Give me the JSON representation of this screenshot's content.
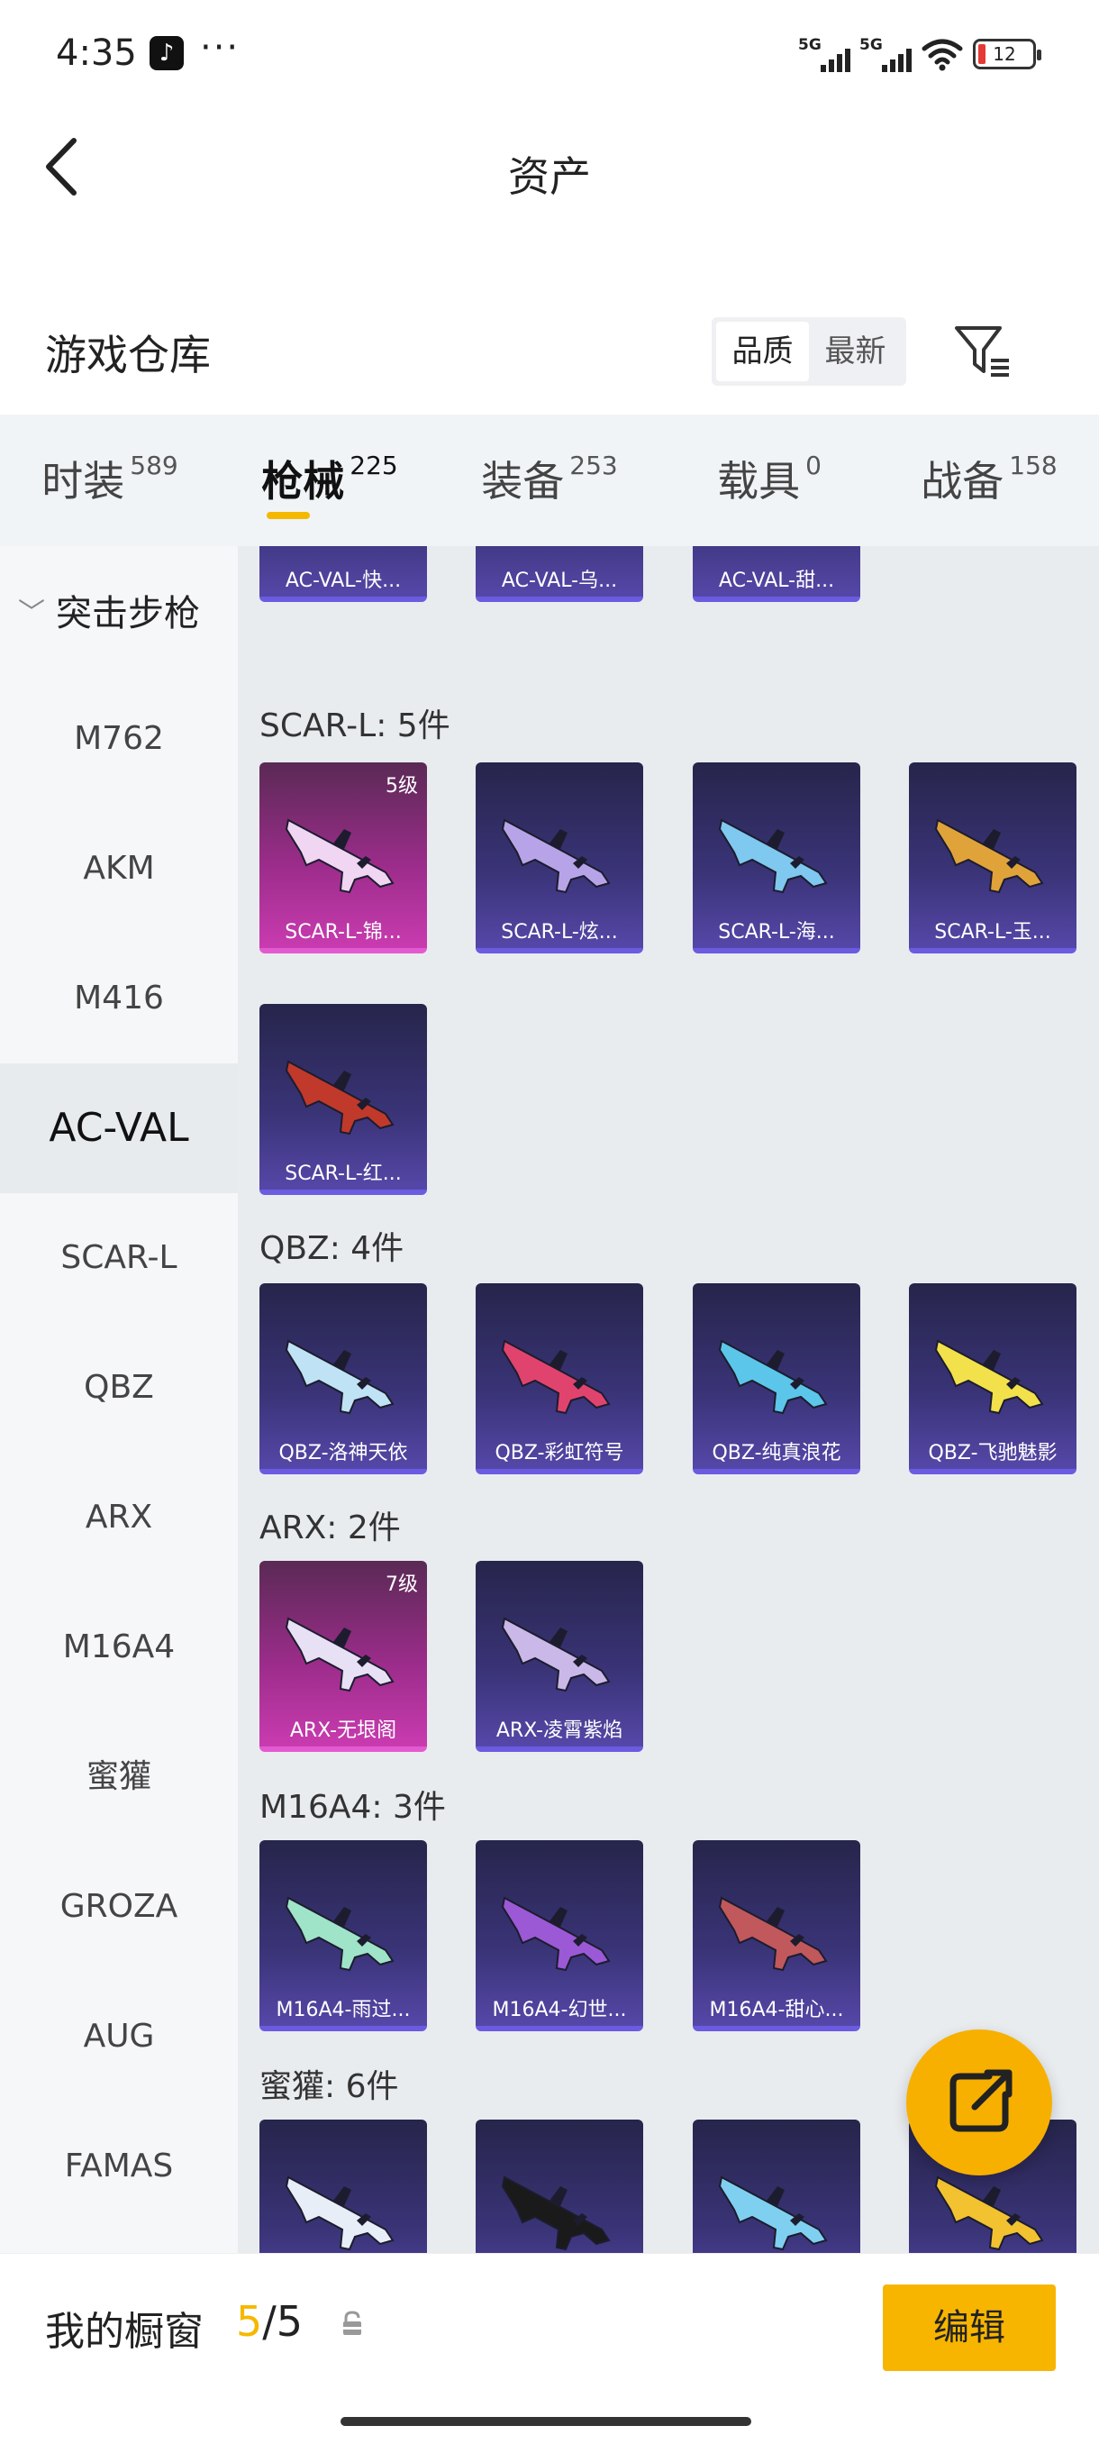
{
  "status_bar": {
    "time": "4:35",
    "app_icon": "tiktok-icon",
    "dots": "···",
    "signal1": "5G",
    "signal2": "5G",
    "battery": "12"
  },
  "nav": {
    "title": "资产",
    "back_icon": "back-arrow-icon"
  },
  "warehouse": {
    "title": "游戏仓库",
    "sort_options": [
      "品质",
      "最新"
    ],
    "selected_sort": "品质",
    "filter_icon": "filter-icon"
  },
  "tabs": [
    {
      "label": "时装",
      "count": "589"
    },
    {
      "label": "枪械",
      "count": "225"
    },
    {
      "label": "装备",
      "count": "253"
    },
    {
      "label": "载具",
      "count": "0"
    },
    {
      "label": "战备",
      "count": "158"
    }
  ],
  "active_tab": "枪械",
  "sidebar": {
    "group": "突击步枪",
    "items": [
      "M762",
      "AKM",
      "M416",
      "AC-VAL",
      "SCAR-L",
      "QBZ",
      "ARX",
      "M16A4",
      "蜜獾",
      "GROZA",
      "AUG",
      "FAMAS"
    ],
    "active": "AC-VAL"
  },
  "groups": [
    {
      "title": "",
      "cards": [
        {
          "name": "AC-VAL-快...",
          "level": "",
          "rarity": "purple"
        },
        {
          "name": "AC-VAL-乌...",
          "level": "",
          "rarity": "purple"
        },
        {
          "name": "AC-VAL-甜...",
          "level": "",
          "rarity": "purple"
        }
      ]
    },
    {
      "title": "SCAR-L: 5件",
      "cards": [
        {
          "name": "SCAR-L-锦...",
          "level": "5级",
          "rarity": "pink"
        },
        {
          "name": "SCAR-L-炫...",
          "level": "",
          "rarity": "purple"
        },
        {
          "name": "SCAR-L-海...",
          "level": "",
          "rarity": "purple"
        },
        {
          "name": "SCAR-L-玉...",
          "level": "",
          "rarity": "purple"
        },
        {
          "name": "SCAR-L-红...",
          "level": "",
          "rarity": "purple"
        }
      ]
    },
    {
      "title": "QBZ: 4件",
      "cards": [
        {
          "name": "QBZ-洛神天依",
          "level": "",
          "rarity": "purple"
        },
        {
          "name": "QBZ-彩虹符号",
          "level": "",
          "rarity": "purple"
        },
        {
          "name": "QBZ-纯真浪花",
          "level": "",
          "rarity": "purple"
        },
        {
          "name": "QBZ-飞驰魅影",
          "level": "",
          "rarity": "purple"
        }
      ]
    },
    {
      "title": "ARX: 2件",
      "cards": [
        {
          "name": "ARX-无垠阁",
          "level": "7级",
          "rarity": "pink"
        },
        {
          "name": "ARX-凌霄紫焰",
          "level": "",
          "rarity": "purple"
        }
      ]
    },
    {
      "title": "M16A4: 3件",
      "cards": [
        {
          "name": "M16A4-雨过...",
          "level": "",
          "rarity": "purple"
        },
        {
          "name": "M16A4-幻世...",
          "level": "",
          "rarity": "purple"
        },
        {
          "name": "M16A4-甜心...",
          "level": "",
          "rarity": "purple"
        }
      ]
    },
    {
      "title": "蜜獾: 6件",
      "cards": [
        {
          "name": "",
          "level": "",
          "rarity": "purple"
        },
        {
          "name": "",
          "level": "",
          "rarity": "purple"
        },
        {
          "name": "",
          "level": "",
          "rarity": "purple"
        },
        {
          "name": "",
          "level": "",
          "rarity": "purple"
        }
      ]
    }
  ],
  "showcase": {
    "title": "我的橱窗",
    "current": "5",
    "total": "5",
    "edit_label": "编辑"
  },
  "colors": {
    "accent": "#f5b800",
    "pink_rarity": "#c93bb0",
    "purple_rarity": "#5547a8"
  }
}
